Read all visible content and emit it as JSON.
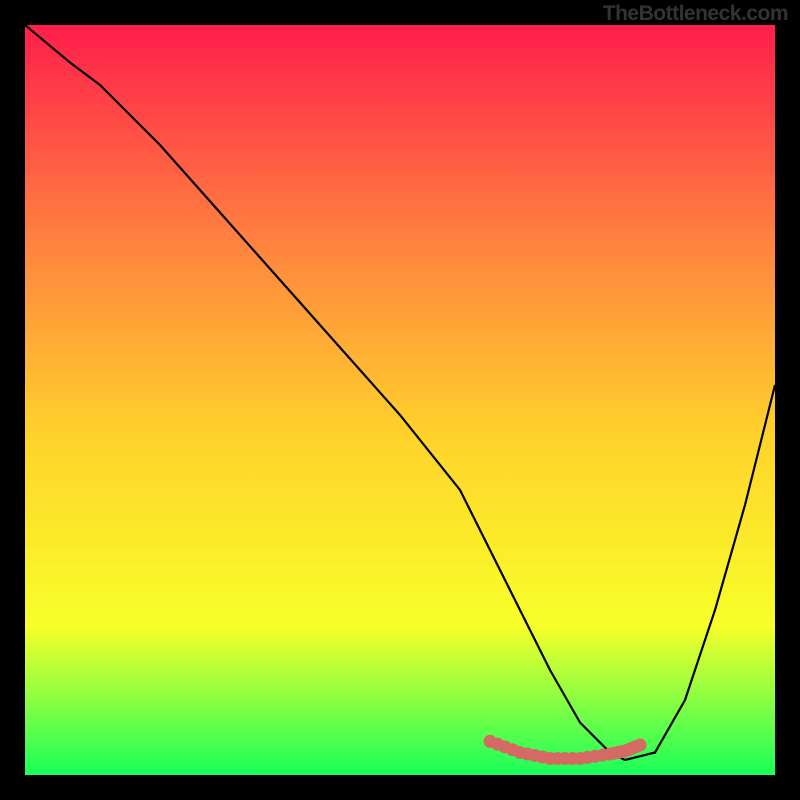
{
  "watermark": "TheBottleneck.com",
  "chart_data": {
    "type": "line",
    "title": "",
    "xlabel": "",
    "ylabel": "",
    "xlim": [
      0,
      100
    ],
    "ylim": [
      0,
      100
    ],
    "series": [
      {
        "name": "bottleneck-curve",
        "style": "black-line",
        "x": [
          0,
          6,
          10,
          18,
          26,
          34,
          42,
          50,
          58,
          62,
          66,
          70,
          74,
          78,
          80,
          84,
          88,
          92,
          96,
          100
        ],
        "values": [
          100,
          95,
          92,
          84,
          75,
          66,
          57,
          48,
          38,
          30,
          22,
          14,
          7,
          3,
          2,
          3,
          10,
          22,
          36,
          52
        ]
      },
      {
        "name": "optimal-band-marker",
        "style": "pink-dotted",
        "x": [
          62,
          66,
          70,
          74,
          78,
          80,
          82
        ],
        "values": [
          4.5,
          3.0,
          2.2,
          2.2,
          2.8,
          3.2,
          4.0
        ]
      }
    ],
    "background_gradient": {
      "top": "#ff1e4b",
      "mid_upper": "#ff863f",
      "mid": "#ffd32b",
      "mid_lower": "#f8ff2a",
      "bottom": "#19ff5a"
    },
    "marker_color": "#d46a63"
  }
}
